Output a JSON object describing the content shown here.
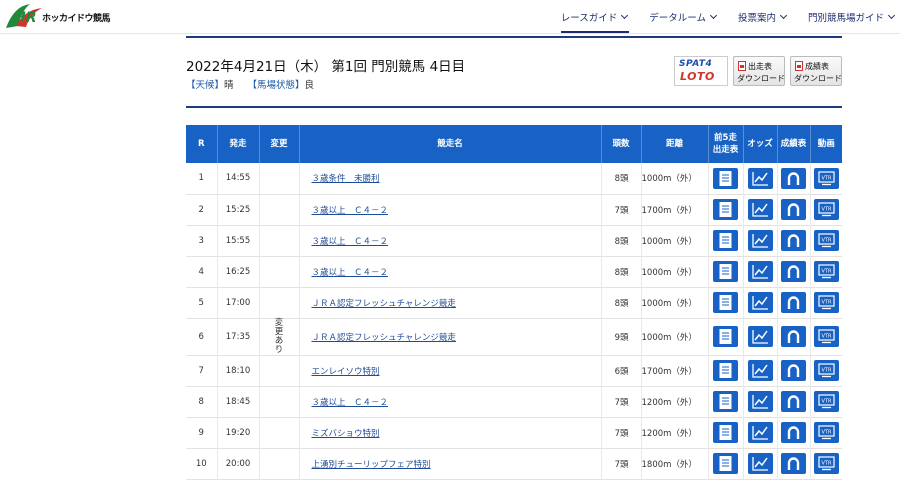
{
  "header": {
    "logo_mark": "HR",
    "logo_text": "ホッカイドウ競馬",
    "nav": [
      {
        "label": "レースガイド",
        "active": true
      },
      {
        "label": "データルーム",
        "active": false
      },
      {
        "label": "投票案内",
        "active": false
      },
      {
        "label": "門別競馬場ガイド",
        "active": false
      }
    ]
  },
  "race_day": {
    "title": "2022年4月21日（木） 第1回 門別競馬 4日目",
    "weather_label": "【天候】",
    "weather": "晴",
    "track_label": "【馬場状態】",
    "track": "良"
  },
  "buttons": {
    "spat_line1": "SPAT4",
    "spat_line2": "LOTO",
    "entries_l1": "出走表",
    "entries_l2": "ダウンロード",
    "results_l1": "成績表",
    "results_l2": "ダウンロード"
  },
  "table": {
    "headers": {
      "r": "R",
      "start": "発走",
      "change": "変更",
      "name": "競走名",
      "heads": "頭数",
      "dist": "距離",
      "prev5_l1": "前5走",
      "prev5_l2": "出走表",
      "odds": "オッズ",
      "results": "成績表",
      "video": "動画"
    },
    "rows": [
      {
        "r": "1",
        "start": "14:55",
        "change": "",
        "name": "３歳条件　未勝利",
        "heads": "8頭",
        "dist": "1000m（外）"
      },
      {
        "r": "2",
        "start": "15:25",
        "change": "",
        "name": "３歳以上　Ｃ４－２",
        "heads": "7頭",
        "dist": "1700m（外）"
      },
      {
        "r": "3",
        "start": "15:55",
        "change": "",
        "name": "３歳以上　Ｃ４－２",
        "heads": "8頭",
        "dist": "1000m（外）"
      },
      {
        "r": "4",
        "start": "16:25",
        "change": "",
        "name": "３歳以上　Ｃ４－２",
        "heads": "8頭",
        "dist": "1000m（外）"
      },
      {
        "r": "5",
        "start": "17:00",
        "change": "",
        "name": "ＪＲＡ認定フレッシュチャレンジ競走",
        "heads": "8頭",
        "dist": "1000m（外）"
      },
      {
        "r": "6",
        "start": "17:35",
        "change": "変更あり",
        "name": "ＪＲＡ認定フレッシュチャレンジ競走",
        "heads": "9頭",
        "dist": "1000m（外）"
      },
      {
        "r": "7",
        "start": "18:10",
        "change": "",
        "name": "エンレイソウ特別",
        "heads": "6頭",
        "dist": "1700m（外）"
      },
      {
        "r": "8",
        "start": "18:45",
        "change": "",
        "name": "３歳以上　Ｃ４－２",
        "heads": "7頭",
        "dist": "1200m（外）"
      },
      {
        "r": "9",
        "start": "19:20",
        "change": "",
        "name": "ミズバショウ特別",
        "heads": "7頭",
        "dist": "1200m（外）"
      },
      {
        "r": "10",
        "start": "20:00",
        "change": "",
        "name": "上湧別チューリップフェア特別",
        "heads": "7頭",
        "dist": "1800m（外）"
      }
    ],
    "icons": {
      "prev5": "document-icon",
      "odds": "line-chart-icon",
      "results": "horseshoe-icon",
      "video": "vtr-monitor-icon",
      "vtr_text": "VTR"
    }
  },
  "colors": {
    "accent": "#1762c4",
    "navy": "#1d2d6b",
    "logo_green": "#1f8a3a",
    "logo_red": "#d0342c"
  }
}
